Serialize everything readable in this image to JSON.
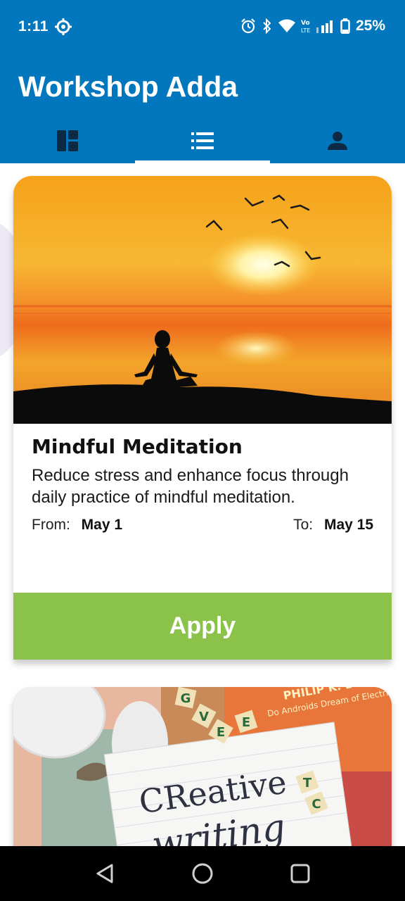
{
  "status_bar": {
    "time": "1:11",
    "battery_text": "25%",
    "icons": [
      "gear-icon",
      "alarm-icon",
      "bluetooth-icon",
      "wifi-icon",
      "volte-icon",
      "signal-icon",
      "battery-icon"
    ]
  },
  "app_bar": {
    "title": "Workshop Adda",
    "tabs": [
      {
        "icon": "dashboard-icon",
        "active": false
      },
      {
        "icon": "list-icon",
        "active": true
      },
      {
        "icon": "person-icon",
        "active": false
      }
    ],
    "color": "#0277bd"
  },
  "workshops": [
    {
      "image": "meditation-sunset-image",
      "title": "Mindful Meditation",
      "description": "Reduce stress and enhance focus through daily practice of mindful meditation.",
      "from_label": "From:",
      "from_value": "May 1",
      "to_label": "To:",
      "to_value": "May 15",
      "button_label": "Apply"
    },
    {
      "image": "creative-writing-image",
      "image_text_line1": "CReative",
      "image_text_line2": "writing",
      "book_text": "PHILIP K. DICK",
      "book_subtitle": "Do Androids Dream of Electric Sheep?",
      "tiles": [
        "G",
        "V",
        "E",
        "E",
        "T",
        "C"
      ]
    }
  ],
  "colors": {
    "apply_button": "#8bc34a",
    "primary": "#0277bd"
  },
  "nav_bar": {
    "buttons": [
      "back-icon",
      "home-icon",
      "recents-icon"
    ]
  }
}
